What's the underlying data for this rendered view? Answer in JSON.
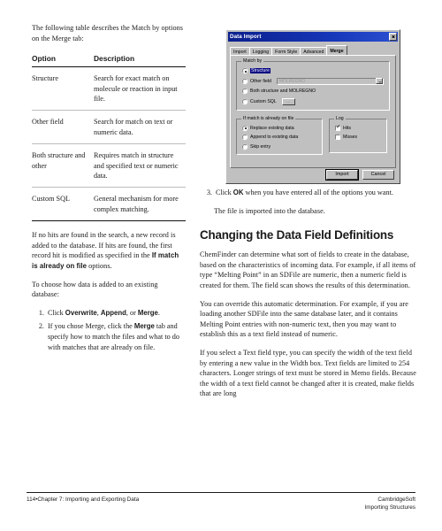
{
  "left_column": {
    "intro": "The following table describes the Match by options on the Merge tab:",
    "table": {
      "headers": [
        "Option",
        "Description"
      ],
      "rows": [
        {
          "option": "Structure",
          "description": "Search for exact match on molecule or reaction in input file."
        },
        {
          "option": "Other field",
          "description": "Search for match on text or numeric data."
        },
        {
          "option": "Both structure and other",
          "description": "Requires match in structure and specified text or numeric data."
        },
        {
          "option": "Custom SQL",
          "description": "General mechanism for more complex matching."
        }
      ]
    },
    "para_nohits_1": "If no hits are found in the search, a new record is added to the database. If hits are found, the first record hit is modified as specified in the ",
    "para_nohits_bold": "If match is already on file",
    "para_nohits_2": " options.",
    "para_choose": "To choose how data is added to an existing database:",
    "steps": [
      {
        "pre": "Click ",
        "bold1": "Overwrite",
        "mid1": ", ",
        "bold2": "Append",
        "mid2": ", or ",
        "bold3": "Merge",
        "post": "."
      },
      {
        "pre": "If you chose Merge, click the ",
        "bold1": "Merge",
        "post": " tab and specify how to match the files and what to do with matches that are already on file."
      }
    ]
  },
  "dialog": {
    "title": "Data Import",
    "close_icon": "close-icon",
    "tabs": [
      {
        "label": "Import",
        "active": false
      },
      {
        "label": "Logging",
        "active": false
      },
      {
        "label": "Form Style",
        "active": false
      },
      {
        "label": "Advanced",
        "active": false
      },
      {
        "label": "Merge",
        "active": true
      }
    ],
    "match_by": {
      "legend": "Match by",
      "options": [
        {
          "label": "Structure",
          "selected": true
        },
        {
          "label": "Other field",
          "selected": false
        },
        {
          "label": "Both structure and MOLREGNO",
          "selected": false
        },
        {
          "label": "Custom SQL",
          "selected": false
        }
      ],
      "other_field_value": "MOLREGNO",
      "custom_sql_button": "..."
    },
    "if_match": {
      "legend": "If match is already on file",
      "options": [
        {
          "label": "Replace existing data",
          "selected": true
        },
        {
          "label": "Append to existing data",
          "selected": false
        },
        {
          "label": "Skip entry",
          "selected": false
        }
      ]
    },
    "log": {
      "legend": "Log",
      "options": [
        {
          "label": "Hits",
          "checked": true
        },
        {
          "label": "Misses",
          "checked": false
        }
      ]
    },
    "buttons": [
      {
        "label": "Import",
        "default": true
      },
      {
        "label": "Cancel",
        "default": false
      }
    ]
  },
  "right_column": {
    "step3": {
      "number": "3.",
      "pre": "Click ",
      "bold": "OK",
      "post": " when you have entered all of the options you want."
    },
    "step3_note": "The file is imported into the database.",
    "heading": "Changing the Data Field Definitions",
    "para1": "ChemFinder can determine what sort of fields to create in the database, based on the characteristics of incoming data. For example, if all items of type “Melting Point” in an SDFile are numeric, then a numeric field is created for them. The field scan shows the results of this determination.",
    "para2": "You can override this automatic determination. For example, if you are loading another SDFile into the same database later, and it contains Melting Point entries with non-numeric text, then you may want to establish this as a text field instead of numeric.",
    "para3": "If you select a Text field type, you can specify the width of the text field by entering a new value in the Width box. Text fields are limited to 254 characters. Longer strings of text must be stored in Memo fields. Because the width of a text field cannot be changed after it is created, make fields that are long"
  },
  "footer": {
    "left": "114•Chapter 7: Importing and Exporting Data",
    "right_line1": "CambridgeSoft",
    "right_line2": "Importing Structures"
  }
}
